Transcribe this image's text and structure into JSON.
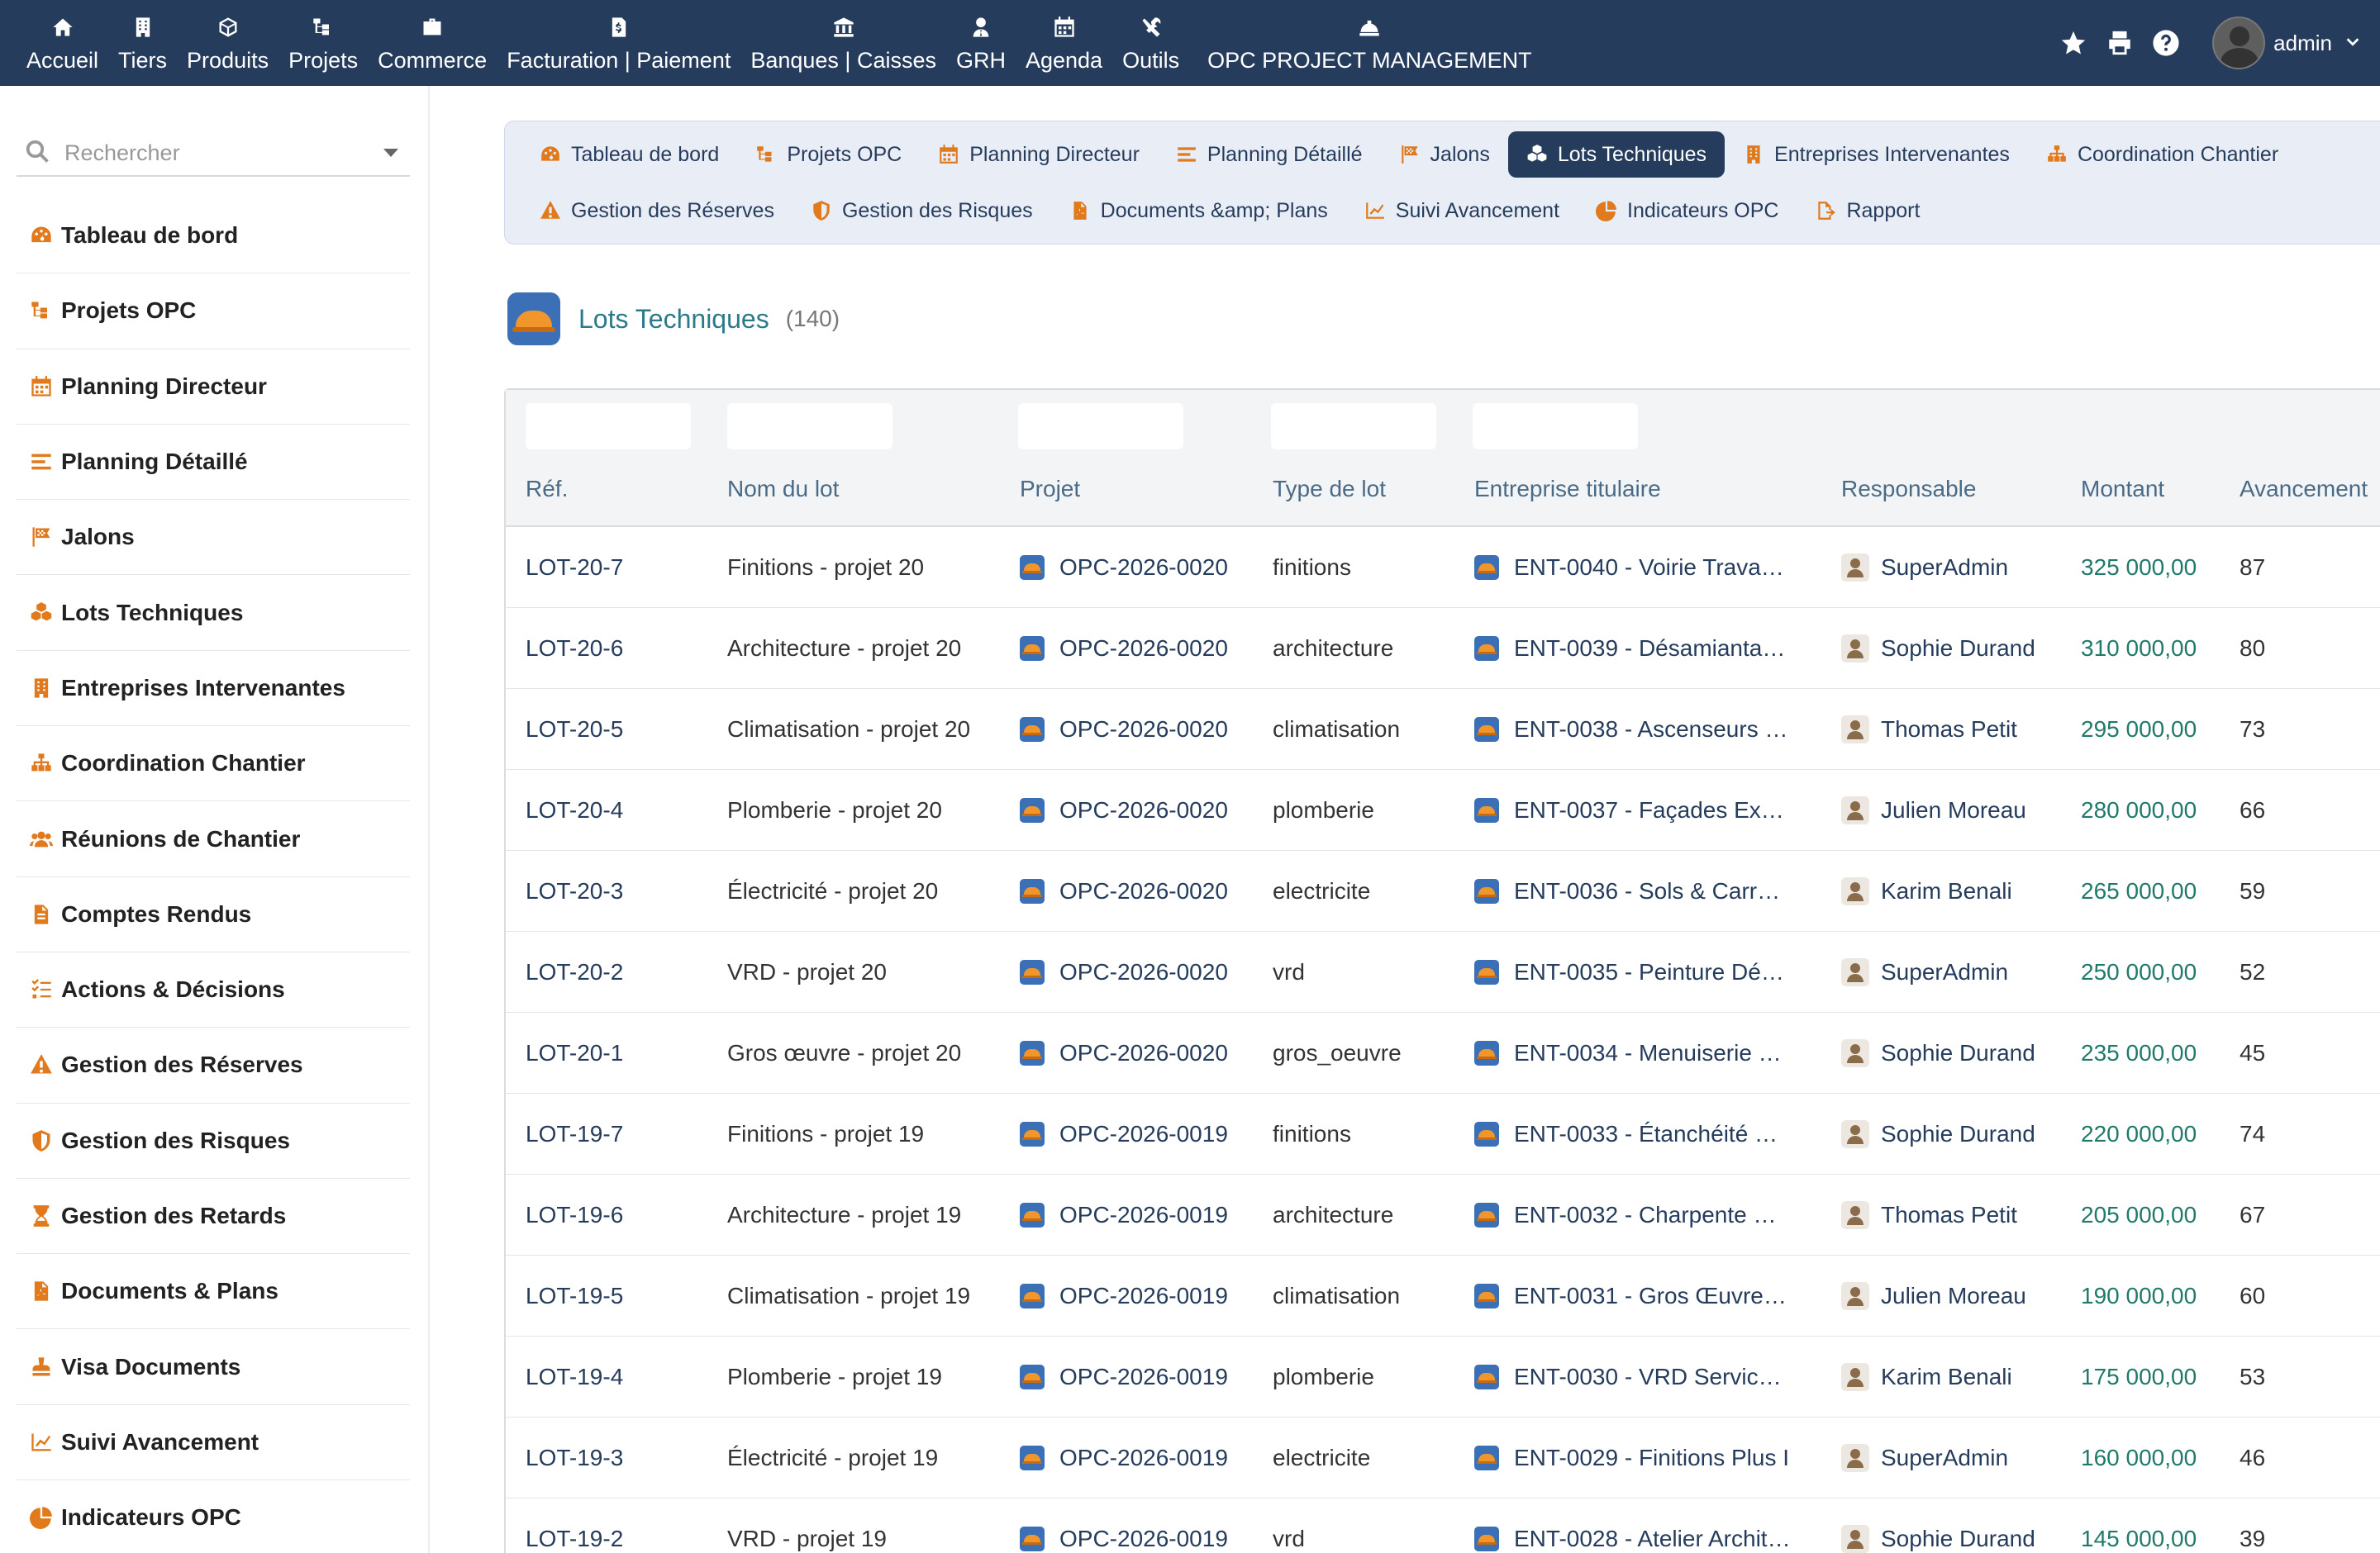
{
  "topnav": {
    "items": [
      {
        "label": "Accueil",
        "icon": "home-icon"
      },
      {
        "label": "Tiers",
        "icon": "building-icon"
      },
      {
        "label": "Produits",
        "icon": "cube-icon"
      },
      {
        "label": "Projets",
        "icon": "project-icon"
      },
      {
        "label": "Commerce",
        "icon": "briefcase-icon"
      },
      {
        "label": "Facturation | Paiement",
        "icon": "invoice-icon"
      },
      {
        "label": "Banques | Caisses",
        "icon": "bank-icon"
      },
      {
        "label": "GRH",
        "icon": "user-tie-icon"
      },
      {
        "label": "Agenda",
        "icon": "calendar-icon"
      },
      {
        "label": "Outils",
        "icon": "tools-icon"
      },
      {
        "label": "OPC PROJECT MANAGEMENT",
        "icon": "hard-hat-icon"
      }
    ],
    "user": "admin"
  },
  "sidebar": {
    "search_placeholder": "Rechercher",
    "items": [
      {
        "label": "Tableau de bord",
        "icon": "dashboard-icon"
      },
      {
        "label": "Projets OPC",
        "icon": "project-icon"
      },
      {
        "label": "Planning Directeur",
        "icon": "calendar-icon"
      },
      {
        "label": "Planning Détaillé",
        "icon": "list-icon"
      },
      {
        "label": "Jalons",
        "icon": "flag-icon"
      },
      {
        "label": "Lots Techniques",
        "icon": "cubes-icon"
      },
      {
        "label": "Entreprises Intervenantes",
        "icon": "building-icon"
      },
      {
        "label": "Coordination Chantier",
        "icon": "sitemap-icon"
      },
      {
        "label": "Réunions de Chantier",
        "icon": "users-icon"
      },
      {
        "label": "Comptes Rendus",
        "icon": "file-icon"
      },
      {
        "label": "Actions & Décisions",
        "icon": "tasks-icon"
      },
      {
        "label": "Gestion des Réserves",
        "icon": "warning-icon"
      },
      {
        "label": "Gestion des Risques",
        "icon": "shield-icon"
      },
      {
        "label": "Gestion des Retards",
        "icon": "hourglass-icon"
      },
      {
        "label": "Documents & Plans",
        "icon": "pdf-icon"
      },
      {
        "label": "Visa Documents",
        "icon": "stamp-icon"
      },
      {
        "label": "Suivi Avancement",
        "icon": "chart-line-icon"
      },
      {
        "label": "Indicateurs OPC",
        "icon": "pie-chart-icon"
      }
    ]
  },
  "tabs": {
    "row1": [
      {
        "label": "Tableau de bord",
        "icon": "dashboard-icon"
      },
      {
        "label": "Projets OPC",
        "icon": "project-icon"
      },
      {
        "label": "Planning Directeur",
        "icon": "calendar-icon"
      },
      {
        "label": "Planning Détaillé",
        "icon": "list-icon"
      },
      {
        "label": "Jalons",
        "icon": "flag-icon"
      },
      {
        "label": "Lots Techniques",
        "icon": "cubes-icon",
        "active": true
      },
      {
        "label": "Entreprises Intervenantes",
        "icon": "building-icon"
      },
      {
        "label": "Coordination Chantier",
        "icon": "sitemap-icon"
      }
    ],
    "row2": [
      {
        "label": "Gestion des Réserves",
        "icon": "warning-icon"
      },
      {
        "label": "Gestion des Risques",
        "icon": "shield-icon"
      },
      {
        "label": "Documents &amp; Plans",
        "icon": "pdf-icon"
      },
      {
        "label": "Suivi Avancement",
        "icon": "chart-line-icon"
      },
      {
        "label": "Indicateurs OPC",
        "icon": "pie-chart-icon"
      },
      {
        "label": "Rapport",
        "icon": "export-icon"
      }
    ]
  },
  "page": {
    "title": "Lots Techniques",
    "count": "(140)"
  },
  "table": {
    "headers": [
      "Réf.",
      "Nom du lot",
      "Projet",
      "Type de lot",
      "Entreprise titulaire",
      "Responsable",
      "Montant",
      "Avancement"
    ],
    "rows": [
      {
        "ref": "LOT-20-7",
        "nom": "Finitions - projet 20",
        "projet": "OPC-2026-0020",
        "type": "finitions",
        "entreprise": "ENT-0040 - Voirie Trava…",
        "responsable": "SuperAdmin",
        "montant": "325 000,00",
        "avancement": "87"
      },
      {
        "ref": "LOT-20-6",
        "nom": "Architecture - projet 20",
        "projet": "OPC-2026-0020",
        "type": "architecture",
        "entreprise": "ENT-0039 - Désamianta…",
        "responsable": "Sophie Durand",
        "montant": "310 000,00",
        "avancement": "80"
      },
      {
        "ref": "LOT-20-5",
        "nom": "Climatisation - projet 20",
        "projet": "OPC-2026-0020",
        "type": "climatisation",
        "entreprise": "ENT-0038 - Ascenseurs …",
        "responsable": "Thomas Petit",
        "montant": "295 000,00",
        "avancement": "73"
      },
      {
        "ref": "LOT-20-4",
        "nom": "Plomberie - projet 20",
        "projet": "OPC-2026-0020",
        "type": "plomberie",
        "entreprise": "ENT-0037 - Façades Ex…",
        "responsable": "Julien Moreau",
        "montant": "280 000,00",
        "avancement": "66"
      },
      {
        "ref": "LOT-20-3",
        "nom": "Électricité - projet 20",
        "projet": "OPC-2026-0020",
        "type": "electricite",
        "entreprise": "ENT-0036 - Sols & Carr…",
        "responsable": "Karim Benali",
        "montant": "265 000,00",
        "avancement": "59"
      },
      {
        "ref": "LOT-20-2",
        "nom": "VRD - projet 20",
        "projet": "OPC-2026-0020",
        "type": "vrd",
        "entreprise": "ENT-0035 - Peinture Dé…",
        "responsable": "SuperAdmin",
        "montant": "250 000,00",
        "avancement": "52"
      },
      {
        "ref": "LOT-20-1",
        "nom": "Gros œuvre - projet 20",
        "projet": "OPC-2026-0020",
        "type": "gros_oeuvre",
        "entreprise": "ENT-0034 - Menuiserie …",
        "responsable": "Sophie Durand",
        "montant": "235 000,00",
        "avancement": "45"
      },
      {
        "ref": "LOT-19-7",
        "nom": "Finitions - projet 19",
        "projet": "OPC-2026-0019",
        "type": "finitions",
        "entreprise": "ENT-0033 - Étanchéité …",
        "responsable": "Sophie Durand",
        "montant": "220 000,00",
        "avancement": "74"
      },
      {
        "ref": "LOT-19-6",
        "nom": "Architecture - projet 19",
        "projet": "OPC-2026-0019",
        "type": "architecture",
        "entreprise": "ENT-0032 - Charpente …",
        "responsable": "Thomas Petit",
        "montant": "205 000,00",
        "avancement": "67"
      },
      {
        "ref": "LOT-19-5",
        "nom": "Climatisation - projet 19",
        "projet": "OPC-2026-0019",
        "type": "climatisation",
        "entreprise": "ENT-0031 - Gros Œuvre…",
        "responsable": "Julien Moreau",
        "montant": "190 000,00",
        "avancement": "60"
      },
      {
        "ref": "LOT-19-4",
        "nom": "Plomberie - projet 19",
        "projet": "OPC-2026-0019",
        "type": "plomberie",
        "entreprise": "ENT-0030 - VRD Servic…",
        "responsable": "Karim Benali",
        "montant": "175 000,00",
        "avancement": "53"
      },
      {
        "ref": "LOT-19-3",
        "nom": "Électricité - projet 19",
        "projet": "OPC-2026-0019",
        "type": "electricite",
        "entreprise": "ENT-0029 - Finitions Plus I",
        "responsable": "SuperAdmin",
        "montant": "160 000,00",
        "avancement": "46"
      },
      {
        "ref": "LOT-19-2",
        "nom": "VRD - projet 19",
        "projet": "OPC-2026-0019",
        "type": "vrd",
        "entreprise": "ENT-0028 - Atelier Archit…",
        "responsable": "Sophie Durand",
        "montant": "145 000,00",
        "avancement": "39"
      }
    ]
  },
  "colors": {
    "topbar": "#263c5c",
    "accent_orange": "#e07a1c",
    "link_navy": "#263c5c",
    "money_teal": "#1f7a6a",
    "title_teal": "#2b7a8c"
  }
}
